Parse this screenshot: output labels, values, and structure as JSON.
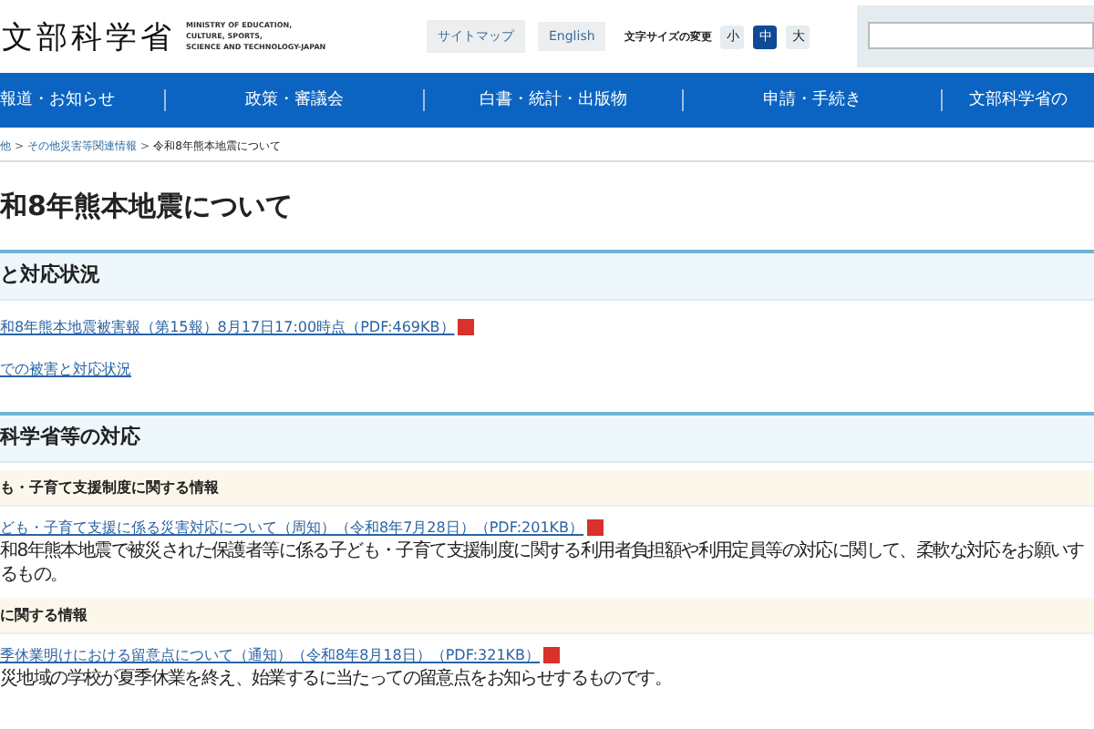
{
  "header": {
    "logo": "文部科学省",
    "logo_english": [
      "MINISTRY OF EDUCATION,",
      "CULTURE, SPORTS,",
      "SCIENCE AND TECHNOLOGY-JAPAN"
    ],
    "links": [
      "サイトマップ",
      "English"
    ],
    "font_size_label": "文字サイズの変更",
    "font_sizes": [
      {
        "label": "小",
        "selected": false
      },
      {
        "label": "中",
        "selected": true
      },
      {
        "label": "大",
        "selected": false
      }
    ]
  },
  "nav": [
    "報道・お知らせ",
    "政策・審議会",
    "白書・統計・出版物",
    "申請・手続き",
    "文部科学省の"
  ],
  "breadcrumb": [
    {
      "kind": "link",
      "text": "他"
    },
    {
      "kind": "separator",
      "text": ">"
    },
    {
      "kind": "link",
      "text": "その他災害等関連情報"
    },
    {
      "kind": "separator",
      "text": ">"
    },
    {
      "kind": "current",
      "text": "令和8年熊本地震について"
    }
  ],
  "title": "和8年熊本地震について",
  "sections": [
    {
      "heading": "と対応状況",
      "blocks": [
        {
          "kind": "link",
          "text": "和8年熊本地震被害報（第15報）8月17日17:00時点（PDF:469KB）",
          "pdf": true
        },
        {
          "kind": "link",
          "text": "での被害と対応状況",
          "pdf": false
        }
      ]
    },
    {
      "heading": "科学省等の対応",
      "blocks": [
        {
          "kind": "subheading",
          "text": "も・子育て支援制度に関する情報"
        },
        {
          "kind": "link",
          "text": "ども・子育て支援に係る災害対応について（周知）（令和8年7月28日）（PDF:201KB）",
          "pdf": true
        },
        {
          "kind": "text",
          "text": "和8年熊本地震で被災された保護者等に係る子ども・子育て支援制度に関する利用者負担額や利用定員等の対応に関して、柔軟な対応をお願いするもの。"
        },
        {
          "kind": "subheading",
          "text": "に関する情報"
        },
        {
          "kind": "link",
          "text": "季休業明けにおける留意点について（通知）（令和8年8月18日）（PDF:321KB）",
          "pdf": true
        },
        {
          "kind": "text",
          "text": "災地域の学校が夏季休業を終え、始業するに当たっての留意点をお知らせするものです。"
        }
      ]
    }
  ]
}
